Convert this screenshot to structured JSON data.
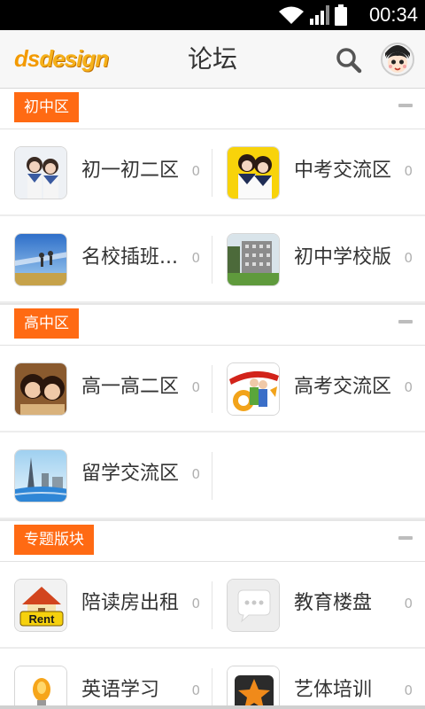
{
  "status": {
    "time": "00:34"
  },
  "appbar": {
    "logo_part1": "ds",
    "logo_part2": "design",
    "title": "论坛"
  },
  "sections": [
    {
      "tag": "初中区",
      "forums": [
        {
          "name": "初一初二区",
          "count": "0"
        },
        {
          "name": "中考交流区",
          "count": "0"
        },
        {
          "name": "名校插班...",
          "count": "0"
        },
        {
          "name": "初中学校版",
          "count": "0"
        }
      ]
    },
    {
      "tag": "高中区",
      "forums": [
        {
          "name": "高一高二区",
          "count": "0"
        },
        {
          "name": "高考交流区",
          "count": "0"
        },
        {
          "name": "留学交流区",
          "count": "0"
        }
      ]
    },
    {
      "tag": "专题版块",
      "forums": [
        {
          "name": "陪读房出租",
          "count": "0"
        },
        {
          "name": "教育楼盘",
          "count": "0"
        },
        {
          "name": "英语学习",
          "count": "0"
        },
        {
          "name": "艺体培训",
          "count": "0"
        }
      ]
    }
  ],
  "colors": {
    "accent": "#ff6a13",
    "logo": "#f39a00"
  },
  "thumb_text": {
    "rent": "Rent"
  }
}
